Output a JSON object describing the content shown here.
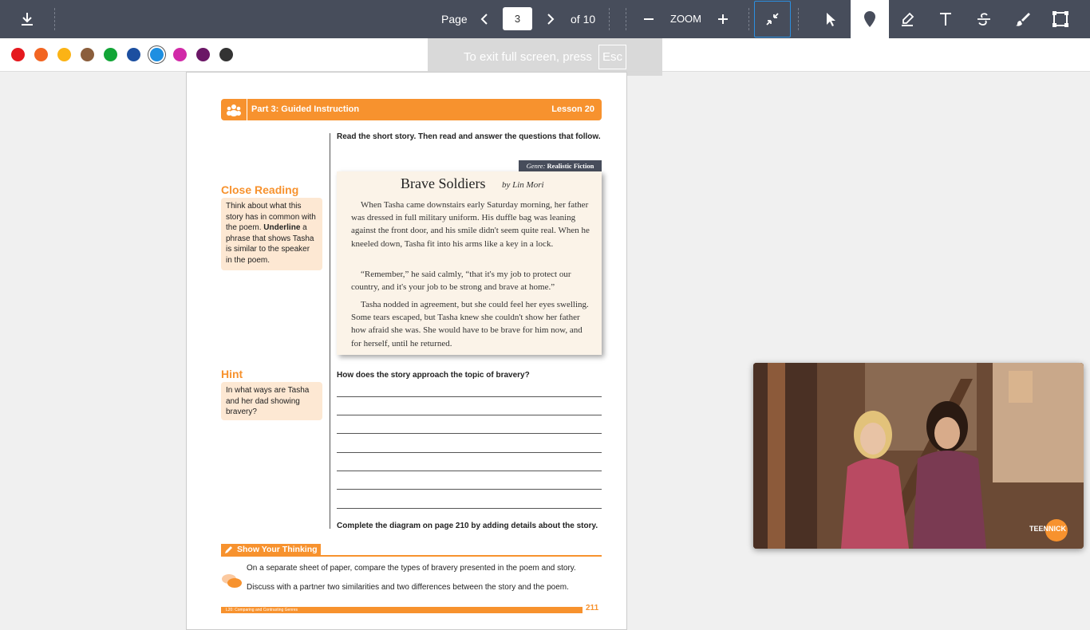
{
  "toolbar": {
    "page_label": "Page",
    "page_value": "3",
    "of_total": "of 10",
    "zoom_label": "ZOOM",
    "icons": [
      "download-icon",
      "chevron-left-icon",
      "chevron-right-icon",
      "minus-icon",
      "plus-icon",
      "collapse-icon",
      "pointer-icon",
      "pin-icon",
      "highlighter-icon",
      "text-icon",
      "strikethrough-icon",
      "brush-icon",
      "crop-icon"
    ]
  },
  "colors": [
    "#e5191e",
    "#f26522",
    "#fbb315",
    "#8b5e3c",
    "#12a537",
    "#1c4fa0",
    "#1e8fe1",
    "#d12aa8",
    "#6b1766",
    "#333333"
  ],
  "selected_color": "#1e8fe1",
  "fullscreen_toast": {
    "text": "To exit full screen, press",
    "key": "Esc"
  },
  "doc": {
    "banner_title": "Part 3: Guided Instruction",
    "banner_lesson": "Lesson 20",
    "instruction": "Read the short story. Then read and answer the questions that follow.",
    "genre_prefix": "Genre:",
    "genre_value": "Realistic Fiction",
    "story_title": "Brave Soldiers",
    "story_author": "by Lin Mori",
    "p1": "When Tasha came downstairs early Saturday morning, her father was dressed in full military uniform. His duffle bag was leaning against the front door, and his smile didn't seem quite real. When he kneeled down, Tasha fit into his arms like a key in a lock.",
    "p2": "“Remember,” he said calmly, “that it's my job to protect our country, and it's your job to be strong and brave at home.”",
    "p3": "Tasha nodded in agreement, but she could feel her eyes swelling. Some tears escaped, but Tasha knew she couldn't show her father how afraid she was. She would have to be brave for him now, and for herself, until he returned.",
    "close_reading_title": "Close Reading",
    "close_reading_pre": "Think about what this story has in common with the poem.",
    "close_reading_bold": "Underline",
    "close_reading_post": "a phrase that shows Tasha is similar to the speaker in the poem.",
    "hint_title": "Hint",
    "hint_text": "In what ways are Tasha and her dad showing bravery?",
    "question": "How does the story approach the topic of bravery?",
    "diagram_note": "Complete the diagram on page 210 by adding details about the story.",
    "syt_title": "Show Your Thinking",
    "syt_line1": "On a separate sheet of paper, compare the types of bravery presented in the poem and story.",
    "syt_line2": "Discuss with a partner two similarities and two differences between the story and the poem.",
    "footer_text": "L20: Comparing and Contrasting Genres",
    "page_number": "211"
  },
  "video": {
    "watermark": "TEENNICK"
  }
}
